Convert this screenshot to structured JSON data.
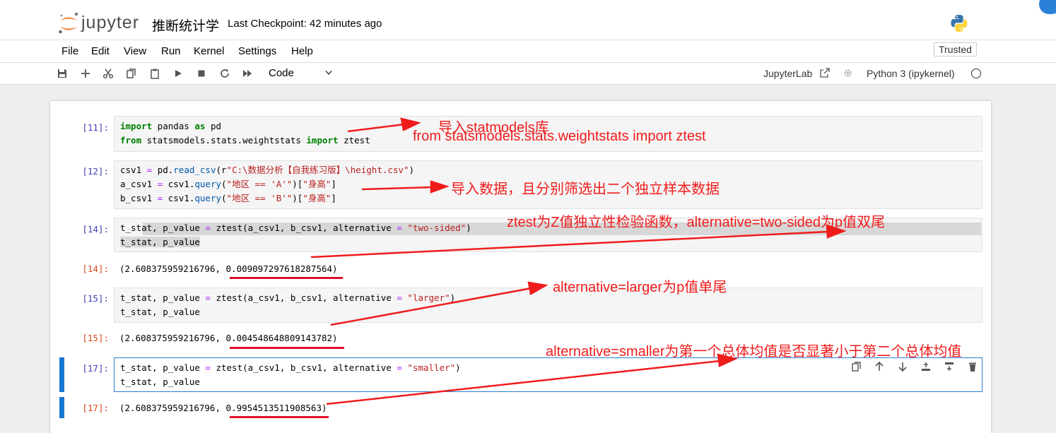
{
  "header": {
    "logo_text": "jupyter",
    "notebook_title": "推断统计学",
    "checkpoint": "Last Checkpoint: 42 minutes ago"
  },
  "menu": {
    "items": [
      "File",
      "Edit",
      "View",
      "Run",
      "Kernel",
      "Settings",
      "Help"
    ],
    "trusted": "Trusted"
  },
  "toolbar": {
    "cell_type": "Code",
    "jupyterlab": "JupyterLab",
    "kernel": "Python 3 (ipykernel)"
  },
  "cells": [
    {
      "prompt": "[11]:",
      "lines": [
        "import pandas as pd",
        "from statsmodels.stats.weightstats import ztest"
      ]
    },
    {
      "prompt": "[12]:",
      "lines": [
        "csv1 = pd.read_csv(r\"C:\\数据分析【自我练习版】\\height.csv\")",
        "a_csv1 = csv1.query(\"地区 == 'A'\")[\"身高\"]",
        "b_csv1 = csv1.query(\"地区 == 'B'\")[\"身高\"]"
      ]
    },
    {
      "prompt": "[14]:",
      "lines": [
        "t_stat, p_value = ztest(a_csv1, b_csv1, alternative = \"two-sided\")",
        "t_stat, p_value"
      ],
      "out_prompt": "[14]:",
      "output": "(2.608375959216796, 0.009097297618287564)"
    },
    {
      "prompt": "[15]:",
      "lines": [
        "t_stat, p_value = ztest(a_csv1, b_csv1, alternative = \"larger\")",
        "t_stat, p_value"
      ],
      "out_prompt": "[15]:",
      "output": "(2.608375959216796, 0.004548648809143782)"
    },
    {
      "prompt": "[17]:",
      "lines": [
        "t_stat, p_value = ztest(a_csv1, b_csv1, alternative = \"smaller\")",
        "t_stat, p_value"
      ],
      "out_prompt": "[17]:",
      "output": "(2.608375959216796, 0.9954513511908563)"
    }
  ],
  "annotations": {
    "a1_line1": "导入statmodels库",
    "a1_line2": "from statsmodels.stats.weightstats import ztest",
    "a2": "导入数据，且分别筛选出二个独立样本数据",
    "a3": "ztest为Z值独立性检验函数，alternative=two-sided为p值双尾",
    "a4": "alternative=larger为p值单尾",
    "a5": "alternative=smaller为第一个总体均值是否显著小于第二个总体均值"
  },
  "colors": {
    "annotation": "#f01c1c",
    "selection": "#1976d2",
    "keyword": "#008000",
    "string": "#ba2121"
  }
}
